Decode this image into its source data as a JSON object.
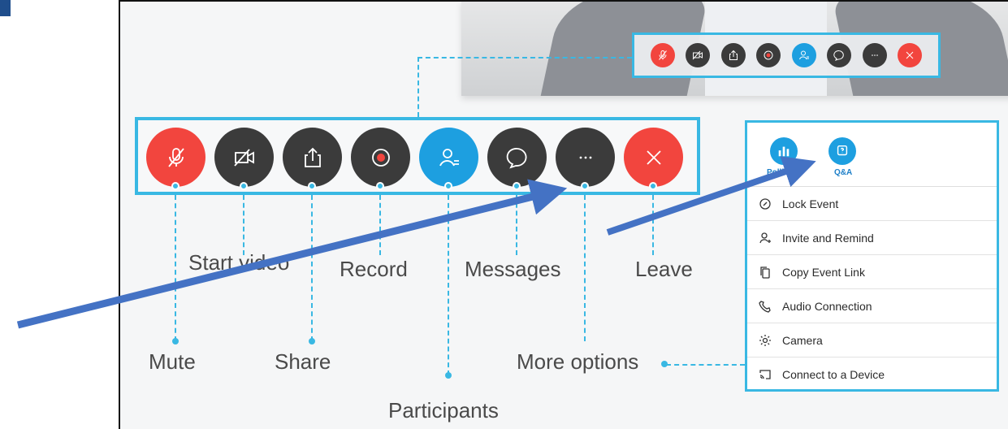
{
  "labels": {
    "mute": "Mute",
    "start_video": "Start video",
    "share": "Share",
    "record": "Record",
    "participants": "Participants",
    "messages": "Messages",
    "more_options": "More options",
    "leave": "Leave"
  },
  "toolbar": {
    "buttons": [
      {
        "name": "mute",
        "icon": "mic-off-icon",
        "color": "#f2453e"
      },
      {
        "name": "start-video",
        "icon": "video-off-icon",
        "color": "#3b3b3b"
      },
      {
        "name": "share",
        "icon": "share-icon",
        "color": "#3b3b3b"
      },
      {
        "name": "record",
        "icon": "record-icon",
        "color": "#3b3b3b"
      },
      {
        "name": "participants",
        "icon": "participants-icon",
        "color": "#1d9fe0"
      },
      {
        "name": "messages",
        "icon": "chat-icon",
        "color": "#3b3b3b"
      },
      {
        "name": "more-options",
        "icon": "more-icon",
        "color": "#3b3b3b"
      },
      {
        "name": "leave",
        "icon": "close-icon",
        "color": "#f2453e"
      }
    ]
  },
  "more_menu": {
    "top": [
      {
        "label": "Polling",
        "icon": "polling-icon"
      },
      {
        "label": "Q&A",
        "icon": "qa-icon"
      }
    ],
    "items": [
      {
        "label": "Lock Event",
        "icon": "lock-icon"
      },
      {
        "label": "Invite and Remind",
        "icon": "invite-icon"
      },
      {
        "label": "Copy Event Link",
        "icon": "copy-icon"
      },
      {
        "label": "Audio Connection",
        "icon": "phone-icon"
      },
      {
        "label": "Camera",
        "icon": "gear-icon"
      },
      {
        "label": "Connect to a Device",
        "icon": "cast-icon"
      }
    ]
  },
  "colors": {
    "accent": "#39b8e3",
    "red": "#f2453e",
    "blue": "#1d9fe0",
    "dark": "#3b3b3b",
    "arrow": "#4472c4"
  }
}
